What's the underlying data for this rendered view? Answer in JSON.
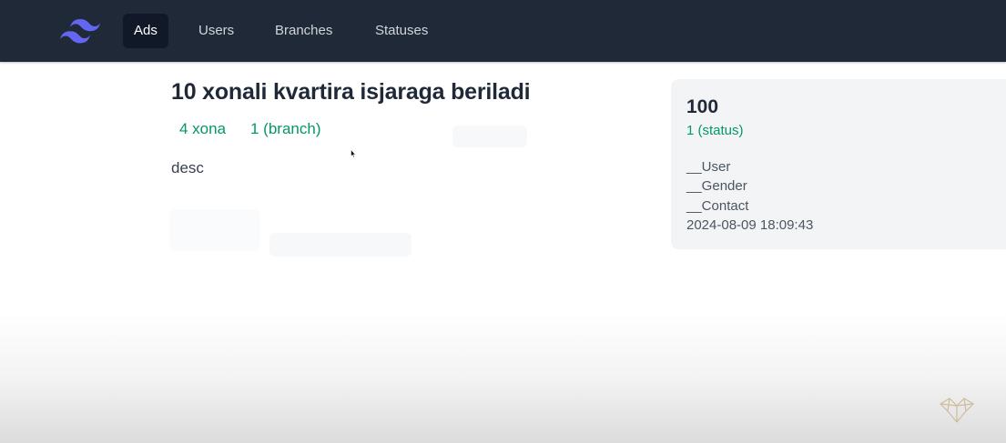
{
  "nav": {
    "logo_icon": "tailwind-logo-icon",
    "links": [
      {
        "label": "Ads",
        "active": true
      },
      {
        "label": "Users",
        "active": false
      },
      {
        "label": "Branches",
        "active": false
      },
      {
        "label": "Statuses",
        "active": false
      }
    ]
  },
  "ad": {
    "title": "10 xonali kvartira isjaraga beriladi",
    "rooms": "4 xona",
    "branch": "1 (branch)",
    "description": "desc"
  },
  "card": {
    "price": "100",
    "status": "1 (status)",
    "user": "__User",
    "gender": "__Gender",
    "contact": "__Contact",
    "created_at": "2024-08-09 18:09:43"
  },
  "colors": {
    "navbar_bg": "#1f2937",
    "nav_active_bg": "#111827",
    "accent_green": "#059669",
    "logo": "#6366f1",
    "card_bg": "#f3f4f6"
  }
}
